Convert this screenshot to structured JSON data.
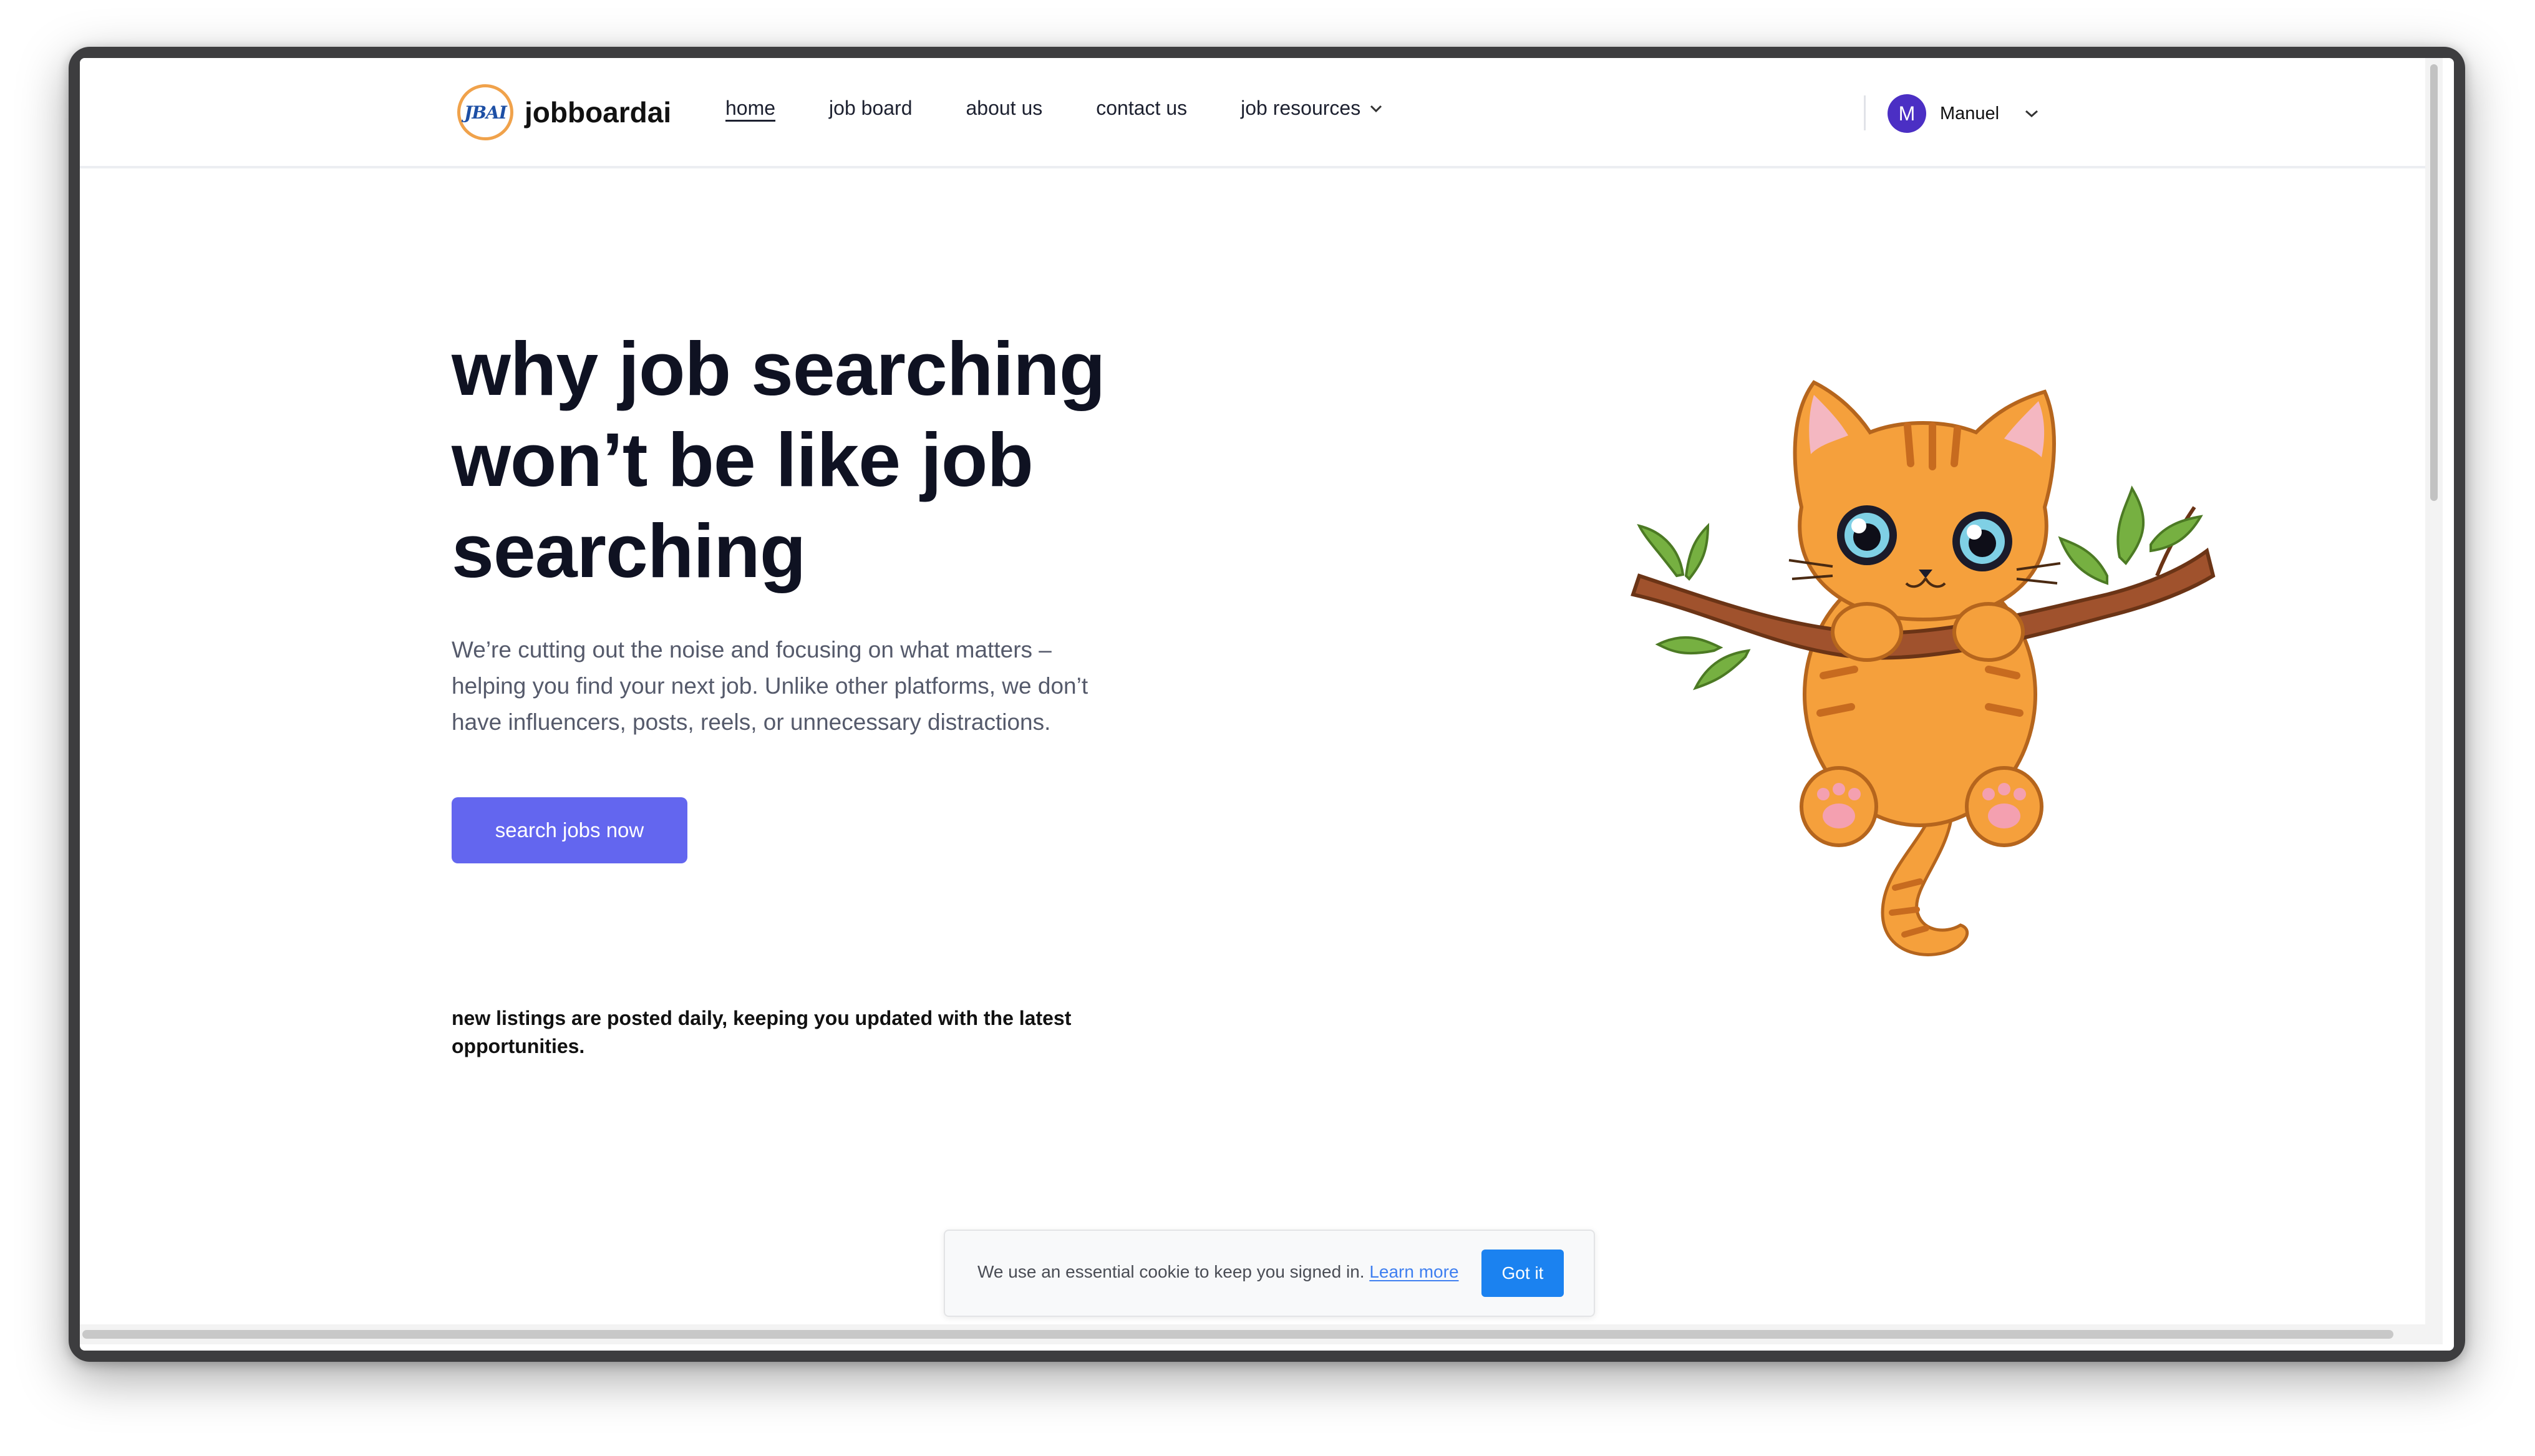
{
  "brand": {
    "logo_text": "JBAI",
    "name": "jobboardai"
  },
  "nav": {
    "items": [
      {
        "label": "home"
      },
      {
        "label": "job board"
      },
      {
        "label": "about us"
      },
      {
        "label": "contact us"
      },
      {
        "label": "job resources"
      }
    ]
  },
  "user": {
    "initial": "M",
    "name": "Manuel"
  },
  "hero": {
    "title": "why job searching won’t be like job searching",
    "description": "We’re cutting out the noise and focusing on what matters – helping you find your next job. Unlike other platforms, we don’t have influencers, posts, reels, or unnecessary distractions.",
    "cta_label": "search jobs now",
    "note": "new listings are posted daily, keeping you updated with the latest opportunities."
  },
  "cookie": {
    "text": "We use an essential cookie to keep you signed in.",
    "link": "Learn more",
    "button": "Got it"
  },
  "colors": {
    "accent": "#6366ef",
    "cookie_button": "#1b82f0",
    "avatar": "#4b2fc4",
    "kitten": "#f5a03c"
  },
  "icons": [
    "chevron-down-icon",
    "kitten-illustration"
  ]
}
